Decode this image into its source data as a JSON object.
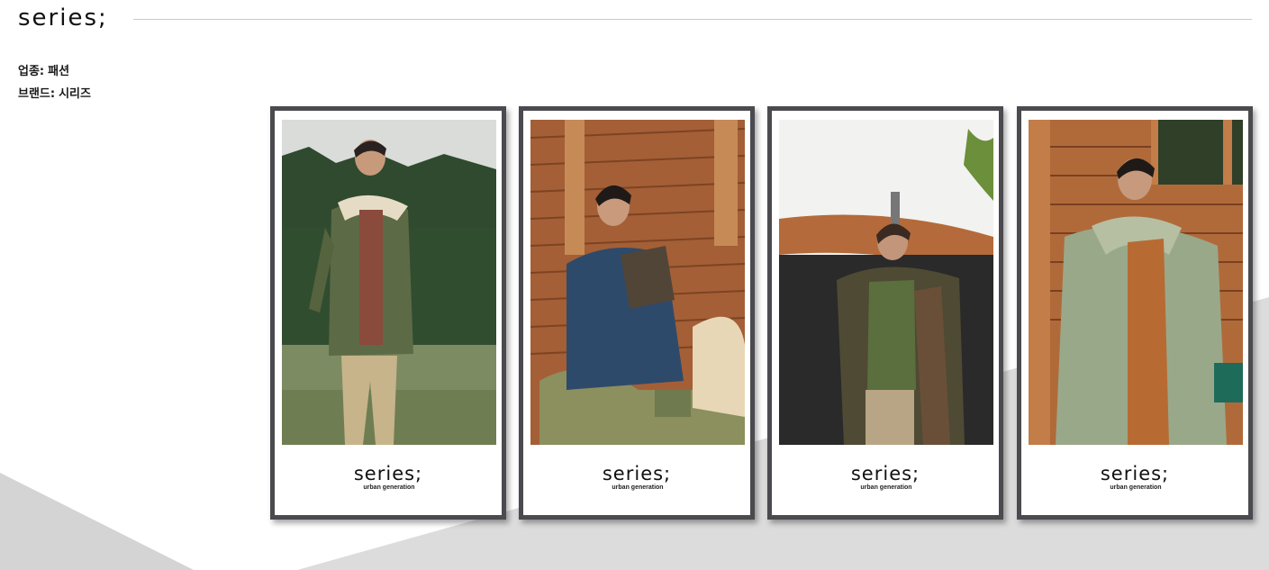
{
  "header": {
    "logo": "series;"
  },
  "info": {
    "industry_label": "업종:",
    "industry_value": "패션",
    "brand_label": "브랜드:",
    "brand_value": "시리즈"
  },
  "cards": [
    {
      "logo": "series;",
      "tagline": "urban generation"
    },
    {
      "logo": "series;",
      "tagline": "urban generation"
    },
    {
      "logo": "series;",
      "tagline": "urban generation"
    },
    {
      "logo": "series;",
      "tagline": "urban generation"
    }
  ],
  "colors": {
    "frame": "#4a4a4f",
    "rule": "#c9c9c9",
    "background_shape": "#d9d9d9"
  }
}
